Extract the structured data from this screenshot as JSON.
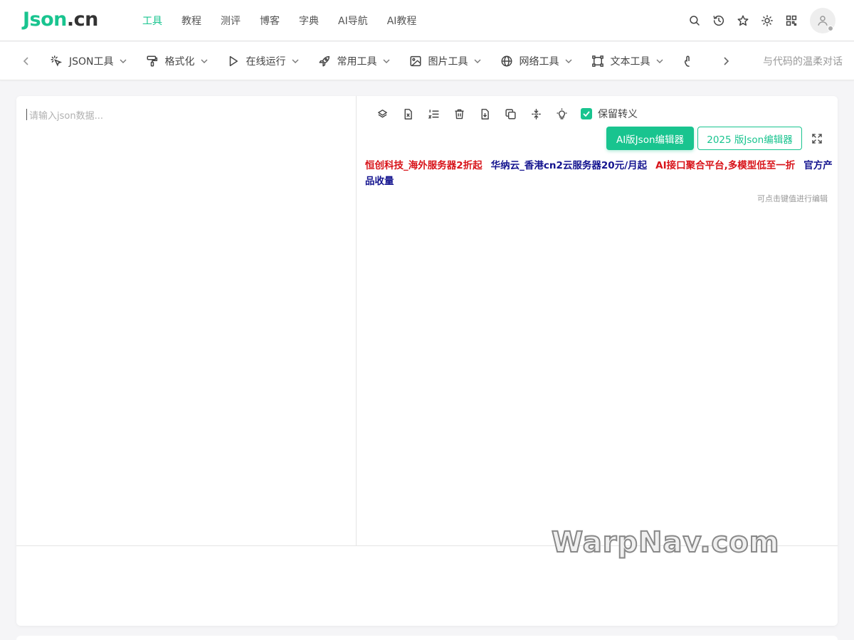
{
  "header": {
    "logo_main": "Json",
    "logo_tld": ".cn",
    "nav": [
      {
        "label": "工具",
        "active": true
      },
      {
        "label": "教程"
      },
      {
        "label": "测评"
      },
      {
        "label": "博客"
      },
      {
        "label": "字典"
      },
      {
        "label": "AI导航"
      },
      {
        "label": "AI教程"
      }
    ],
    "icons": [
      "search-icon",
      "history-icon",
      "star-icon",
      "theme-sun-icon",
      "qr-icon",
      "user-avatar"
    ]
  },
  "toolbar": {
    "items": [
      {
        "label": "JSON工具",
        "icon": "sparkle-click-icon"
      },
      {
        "label": "格式化",
        "icon": "paint-roller-icon"
      },
      {
        "label": "在线运行",
        "icon": "play-icon"
      },
      {
        "label": "常用工具",
        "icon": "rocket-icon"
      },
      {
        "label": "图片工具",
        "icon": "image-icon"
      },
      {
        "label": "网络工具",
        "icon": "globe-icon"
      },
      {
        "label": "文本工具",
        "icon": "text-frame-icon"
      },
      {
        "label": "",
        "icon": "hand-icon"
      }
    ],
    "slogan": "与代码的温柔对话"
  },
  "editor": {
    "placeholder": "请输入json数据...",
    "keep_escape_label": "保留转义",
    "keep_escape_checked": true,
    "ai_button": "AI版Json编辑器",
    "v2025_button": "2025 版Json编辑器",
    "hint": "可点击键值进行编辑",
    "ads": [
      {
        "text": "恒创科技_海外服务器2折起",
        "color": "red"
      },
      {
        "text": "华纳云_香港cn2云服务器20元/月起",
        "color": "blue"
      },
      {
        "text": "AI接口聚合平台,多模型低至一折",
        "color": "red"
      },
      {
        "text": "官方产品收量",
        "color": "blue"
      }
    ]
  },
  "watermark": "WarpNav.com",
  "colors": {
    "accent": "#19c48f",
    "ad_red": "#d8141a",
    "ad_blue": "#14148f"
  }
}
